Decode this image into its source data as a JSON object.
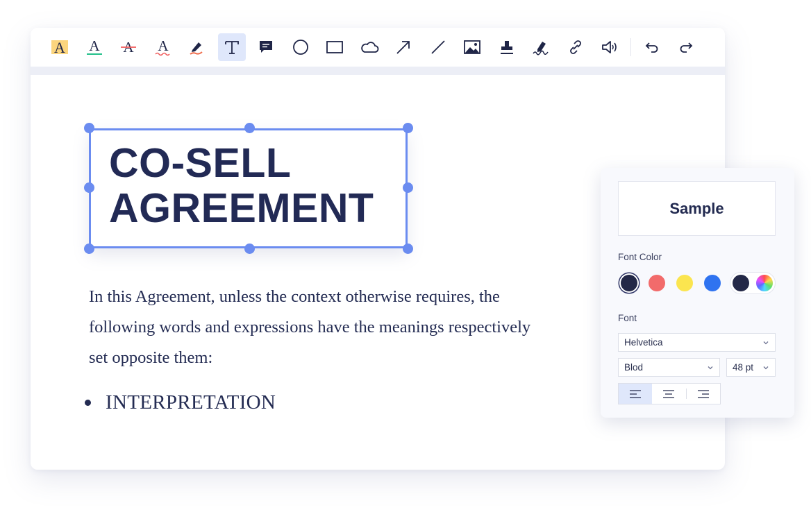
{
  "document": {
    "title_line1": "CO-SELL",
    "title_line2": "AGREEMENT",
    "paragraph_line1": "In this Agreement, unless the context otherwise requires, the",
    "paragraph_line2": "following words and expressions have the meanings respectively",
    "paragraph_line3": "set opposite them:",
    "bullet": "INTERPRETATION"
  },
  "toolbar": {
    "tools": [
      "highlight-text",
      "underline-text",
      "strikethrough-text",
      "squiggly-text",
      "pencil",
      "text-box",
      "note",
      "circle",
      "rectangle",
      "cloud",
      "arrow",
      "line",
      "image",
      "stamp",
      "signature",
      "link",
      "audio"
    ],
    "active_tool": "text-box",
    "history": [
      "undo",
      "redo"
    ],
    "highlight_glyph": "A",
    "underline_glyph": "A",
    "strike_glyph": "A",
    "squiggly_glyph": "A"
  },
  "panel": {
    "sample": "Sample",
    "font_color_label": "Font Color",
    "colors": [
      "#232847",
      "#f26b6b",
      "#fbe54f",
      "#2f73f0",
      "#232847"
    ],
    "selected_color": "#232847",
    "font_label": "Font",
    "font_family": "Helvetica",
    "font_weight": "Blod",
    "font_size": "48 pt",
    "alignments": [
      "left",
      "center",
      "right"
    ],
    "active_alignment": "left"
  },
  "colors": {
    "accent": "#6b8cf0",
    "text": "#222a55"
  }
}
